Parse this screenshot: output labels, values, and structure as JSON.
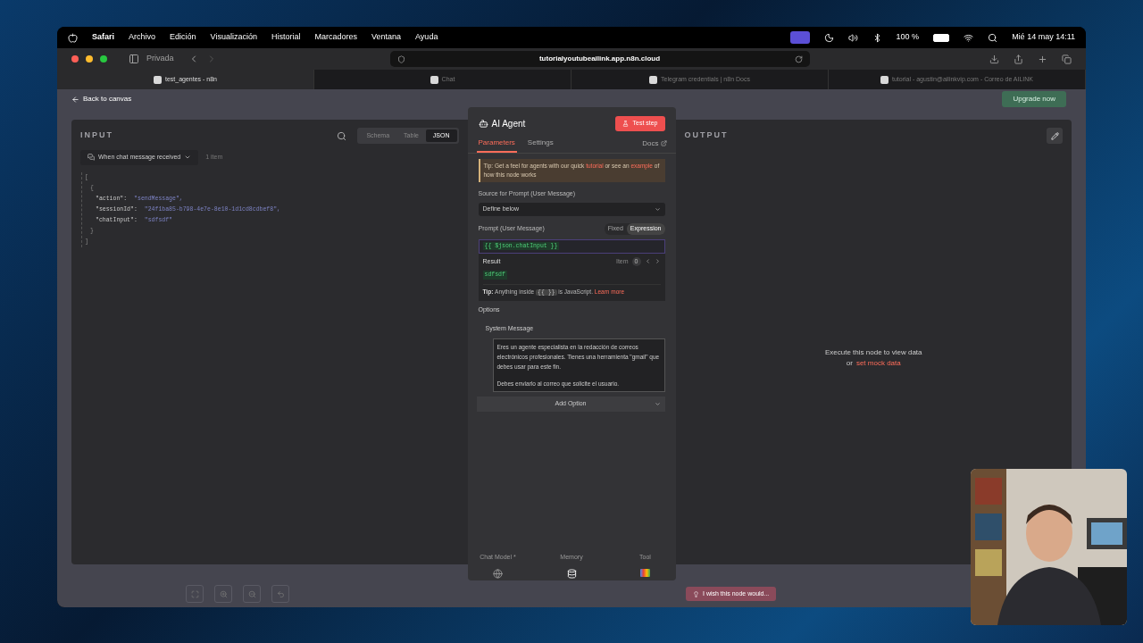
{
  "menu_bar": {
    "app": "Safari",
    "items": [
      "Archivo",
      "Edición",
      "Visualización",
      "Historial",
      "Marcadores",
      "Ventana",
      "Ayuda"
    ],
    "battery": "100 %",
    "clock": "Mié 14 may 14:11"
  },
  "browser": {
    "profile": "Privada",
    "url": "tutorialyoutubeailink.app.n8n.cloud",
    "tabs": [
      {
        "title": "test_agentes - n8n",
        "selected": true
      },
      {
        "title": "Chat",
        "selected": false
      },
      {
        "title": "Telegram credentials | n8n Docs",
        "selected": false
      },
      {
        "title": "tutorial - agustin@ailinkvip.com - Correo de AILINK",
        "selected": false
      }
    ]
  },
  "canvas": {
    "back": "Back to canvas",
    "upgrade": "Upgrade now"
  },
  "input": {
    "title": "INPUT",
    "views": [
      {
        "label": "Schema",
        "selected": false
      },
      {
        "label": "Table",
        "selected": false
      },
      {
        "label": "JSON",
        "selected": true
      }
    ],
    "source": "When chat message received",
    "count": "1 item",
    "json_lines": [
      {
        "kind": "bracket",
        "text": "["
      },
      {
        "kind": "bracket",
        "text": "{"
      },
      {
        "kind": "pair",
        "key": "\"action\":",
        "value": "\"sendMessage\","
      },
      {
        "kind": "pair",
        "key": "\"sessionId\":",
        "value": "\"24f1ba85-b798-4e7e-8e10-1d1cd8cdbef8\","
      },
      {
        "kind": "pair",
        "key": "\"chatInput\":",
        "value": "\"sdfsdf\""
      },
      {
        "kind": "bracket",
        "text": "}"
      },
      {
        "kind": "bracket",
        "text": "]"
      }
    ]
  },
  "node": {
    "title": "AI Agent",
    "test_button": "Test step",
    "tabs": [
      {
        "label": "Parameters",
        "selected": true
      },
      {
        "label": "Settings",
        "selected": false
      }
    ],
    "docs": "Docs",
    "tip": [
      {
        "kind": "text",
        "text": "Tip: Get a feel for agents with our quick"
      },
      {
        "kind": "link",
        "text": "tutorial"
      },
      {
        "kind": "text",
        "text": "or see an"
      },
      {
        "kind": "link",
        "text": "example"
      },
      {
        "kind": "text",
        "text": "of how this node works"
      }
    ],
    "source_label": "Source for Prompt (User Message)",
    "source_value": "Define below",
    "prompt_label": "Prompt (User Message)",
    "modes": [
      {
        "label": "Fixed",
        "selected": false
      },
      {
        "label": "Expression",
        "selected": true
      }
    ],
    "expression": "{{ $json.chatInput }}",
    "result_label": "Result",
    "item_label": "Item",
    "item_index": "0",
    "result": "sdfsdf",
    "hint": [
      {
        "kind": "bold",
        "text": "Tip:"
      },
      {
        "kind": "text",
        "text": "Anything inside"
      },
      {
        "kind": "code",
        "text": "{{ }}"
      },
      {
        "kind": "text",
        "text": "is JavaScript."
      },
      {
        "kind": "link",
        "text": "Learn more"
      }
    ],
    "options_label": "Options",
    "system_label": "System Message",
    "system_message": [
      "Eres un agente especialista en la redacción de correos electrónicos profesionales. Tienes una herramienta \"gmail\" que debes usar para este fin.",
      "Debes enviarlo al correo que solicite el usuario."
    ],
    "add_option": "Add Option",
    "connectors": [
      {
        "label": "Chat Model *",
        "kind": "model"
      },
      {
        "label": "Memory",
        "kind": "memory"
      },
      {
        "label": "Tool",
        "kind": "tool"
      }
    ]
  },
  "feedback": "I wish this node would...",
  "output": {
    "title": "OUTPUT",
    "message": "Execute this node to view data",
    "or": "or",
    "link": "set mock data"
  }
}
